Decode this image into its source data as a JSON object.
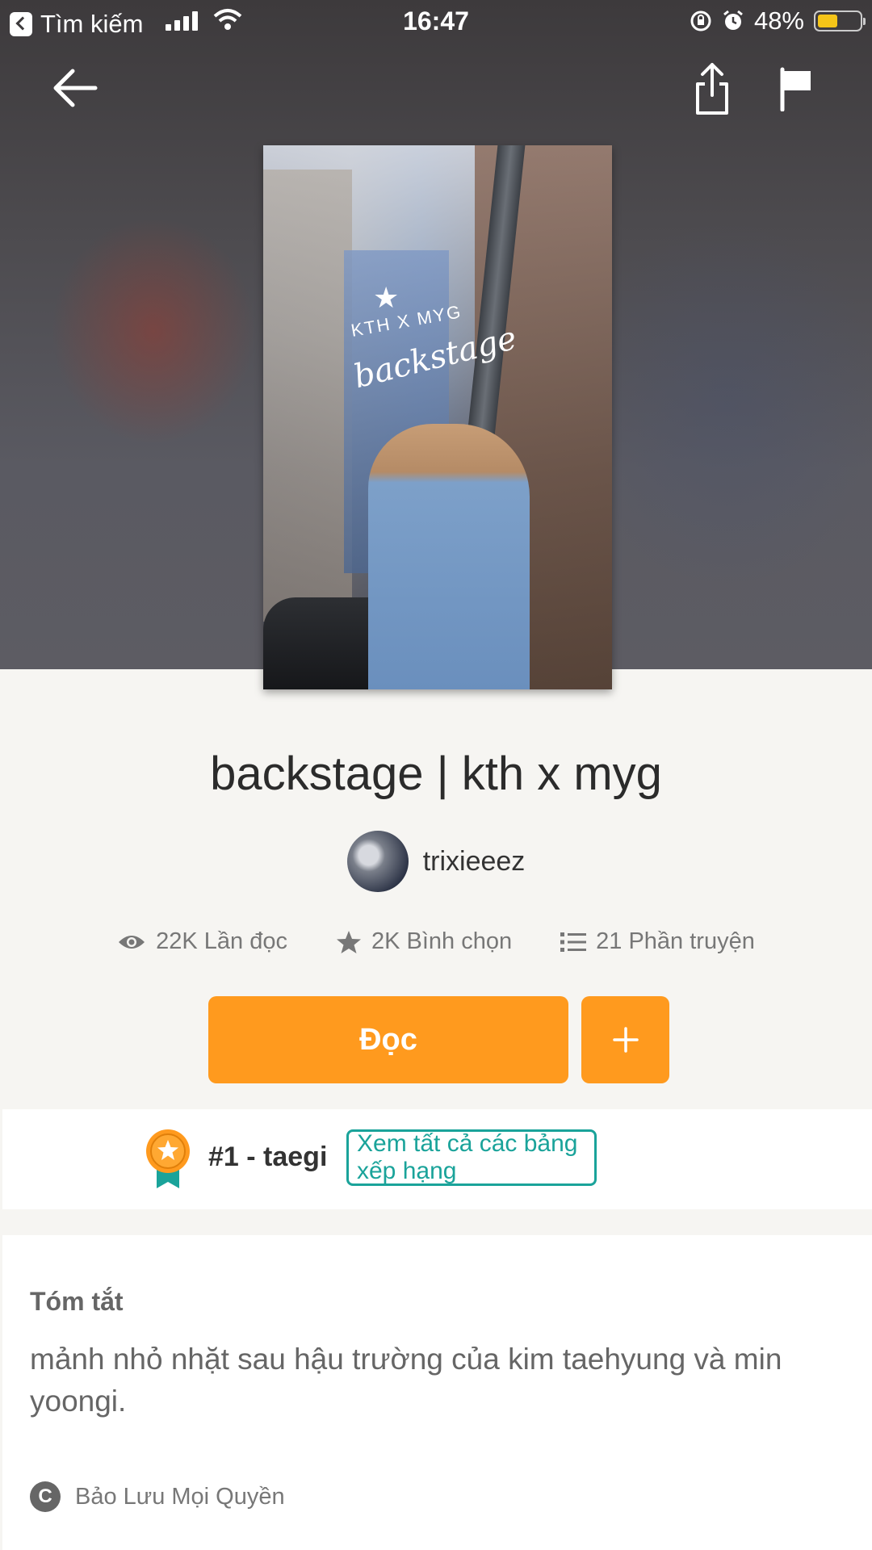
{
  "status_bar": {
    "back_app_label": "Tìm kiếm",
    "time": "16:47",
    "battery": "48%",
    "battery_level": 0.48
  },
  "nav": {
    "back_icon": "arrow-left-icon",
    "share_icon": "share-icon",
    "report_icon": "flag-icon"
  },
  "story": {
    "title": "backstage | kth x myg",
    "author": "trixieeez",
    "cover_text_top": "KTH X MYG",
    "cover_text_script": "backstage"
  },
  "stats": {
    "reads": "22K Lần đọc",
    "votes": "2K Bình chọn",
    "parts": "21 Phần truyện"
  },
  "actions": {
    "read_label": "Đọc",
    "add_label": "+"
  },
  "ranking": {
    "rank_label": "#1 - taegi",
    "view_all_label": "Xem tất cả các bảng xếp hạng"
  },
  "summary": {
    "heading": "Tóm tắt",
    "text": "mảnh nhỏ nhặt sau hậu trường của kim taehyung và min yoongi.",
    "copyright": "Bảo Lưu Mọi Quyền"
  },
  "colors": {
    "accent": "#ff9a1e",
    "teal": "#1aa39a",
    "background": "#f6f5f2"
  }
}
